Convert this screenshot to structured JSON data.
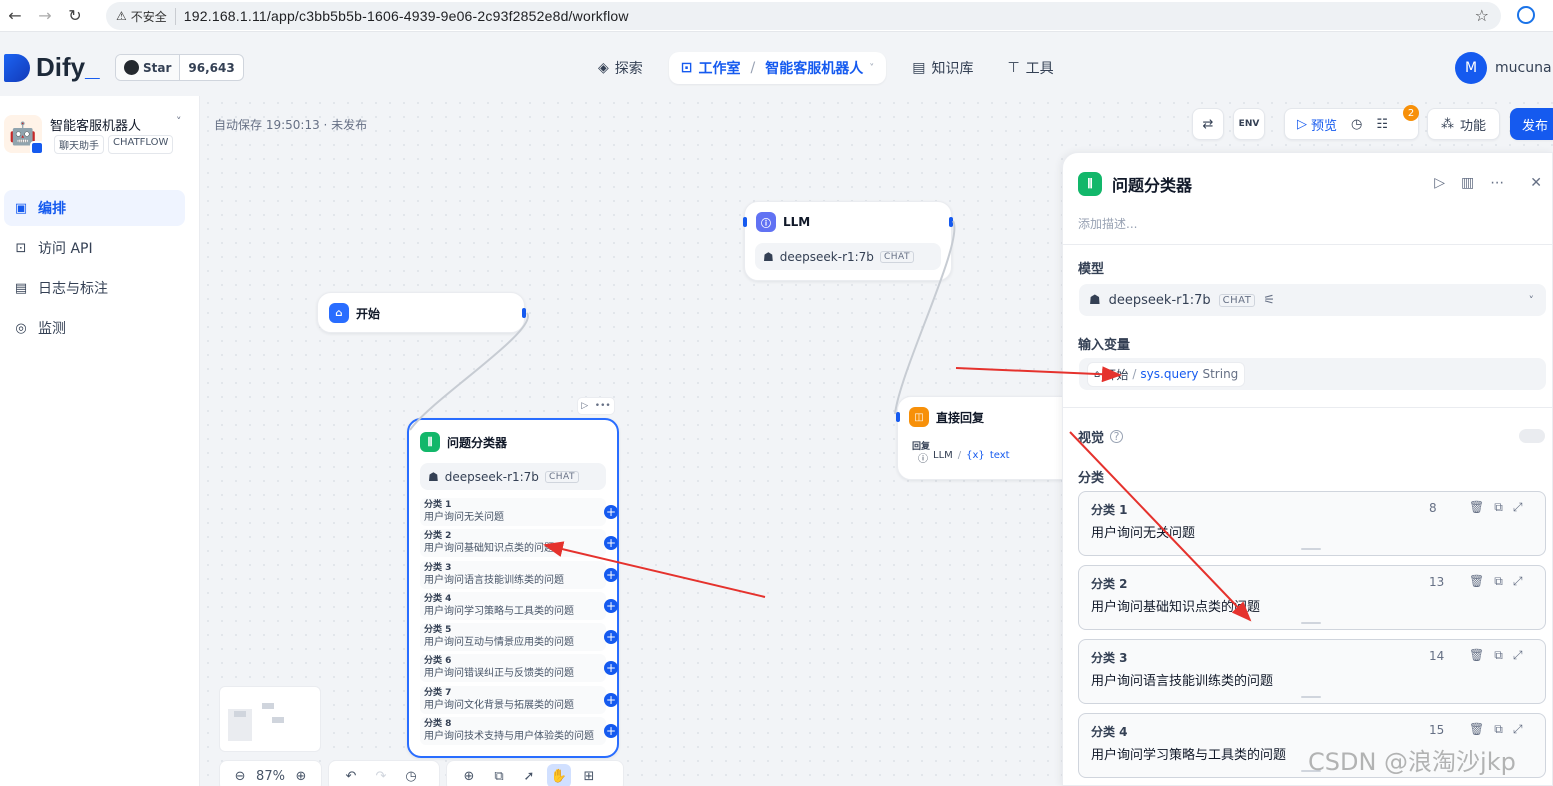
{
  "browser": {
    "insecure_label": "不安全",
    "url": "192.168.1.11/app/c3bb5b5b-1606-4939-9e06-2c93f2852e8d/workflow"
  },
  "header": {
    "logo_text": "Dify",
    "github": {
      "star_label": "Star",
      "count": "96,643"
    },
    "nav": {
      "explore": "探索",
      "studio": "工作室",
      "app_name": "智能客服机器人",
      "knowledge": "知识库",
      "tools": "工具"
    },
    "user": {
      "initial": "M",
      "name": "mucuna"
    }
  },
  "sidebar": {
    "app_name": "智能客服机器人",
    "tags": [
      "聊天助手",
      "CHATFLOW"
    ],
    "items": [
      {
        "label": "编排",
        "icon": "orchestrate-icon"
      },
      {
        "label": "访问 API",
        "icon": "terminal-icon"
      },
      {
        "label": "日志与标注",
        "icon": "log-icon"
      },
      {
        "label": "监测",
        "icon": "monitor-icon"
      }
    ]
  },
  "canvas": {
    "autosave": "自动保存 19:50:13 · 未发布",
    "zoom": "87%",
    "toolbar": {
      "preview": "预览",
      "feature": "功能",
      "publish": "发布",
      "env": "ENV",
      "notif_count": "2"
    },
    "nodes": {
      "start": {
        "title": "开始"
      },
      "llm": {
        "title": "LLM",
        "model": "deepseek-r1:7b",
        "mode": "CHAT"
      },
      "answer": {
        "title": "直接回复",
        "label": "回复",
        "var_node": "LLM",
        "var_name": "text"
      },
      "classifier": {
        "title": "问题分类器",
        "model": "deepseek-r1:7b",
        "mode": "CHAT",
        "classes": [
          {
            "title": "分类 1",
            "desc": "用户询问无关问题"
          },
          {
            "title": "分类 2",
            "desc": "用户询问基础知识点类的问题"
          },
          {
            "title": "分类 3",
            "desc": "用户询问语言技能训练类的问题"
          },
          {
            "title": "分类 4",
            "desc": "用户询问学习策略与工具类的问题"
          },
          {
            "title": "分类 5",
            "desc": "用户询问互动与情景应用类的问题"
          },
          {
            "title": "分类 6",
            "desc": "用户询问错误纠正与反馈类的问题"
          },
          {
            "title": "分类 7",
            "desc": "用户询问文化背景与拓展类的问题"
          },
          {
            "title": "分类 8",
            "desc": "用户询问技术支持与用户体验类的问题"
          }
        ]
      }
    }
  },
  "panel": {
    "title": "问题分类器",
    "desc_placeholder": "添加描述...",
    "model_label": "模型",
    "model": "deepseek-r1:7b",
    "mode": "CHAT",
    "input_label": "输入变量",
    "input_node": "开始",
    "input_var": "sys.query",
    "input_type": "String",
    "vision_label": "视觉",
    "class_label": "分类",
    "classes": [
      {
        "title": "分类 1",
        "desc": "用户询问无关问题",
        "count": "8"
      },
      {
        "title": "分类 2",
        "desc": "用户询问基础知识点类的问题",
        "count": "13"
      },
      {
        "title": "分类 3",
        "desc": "用户询问语言技能训练类的问题",
        "count": "14"
      },
      {
        "title": "分类 4",
        "desc": "用户询问学习策略与工具类的问题",
        "count": "15"
      }
    ]
  },
  "watermark": "CSDN @浪淘沙jkp",
  "colors": {
    "brand": "#155aef",
    "classifier": "#12b76a",
    "llm": "#6172f3",
    "answer": "#f79009",
    "annotation_arrow": "#e5322d"
  }
}
